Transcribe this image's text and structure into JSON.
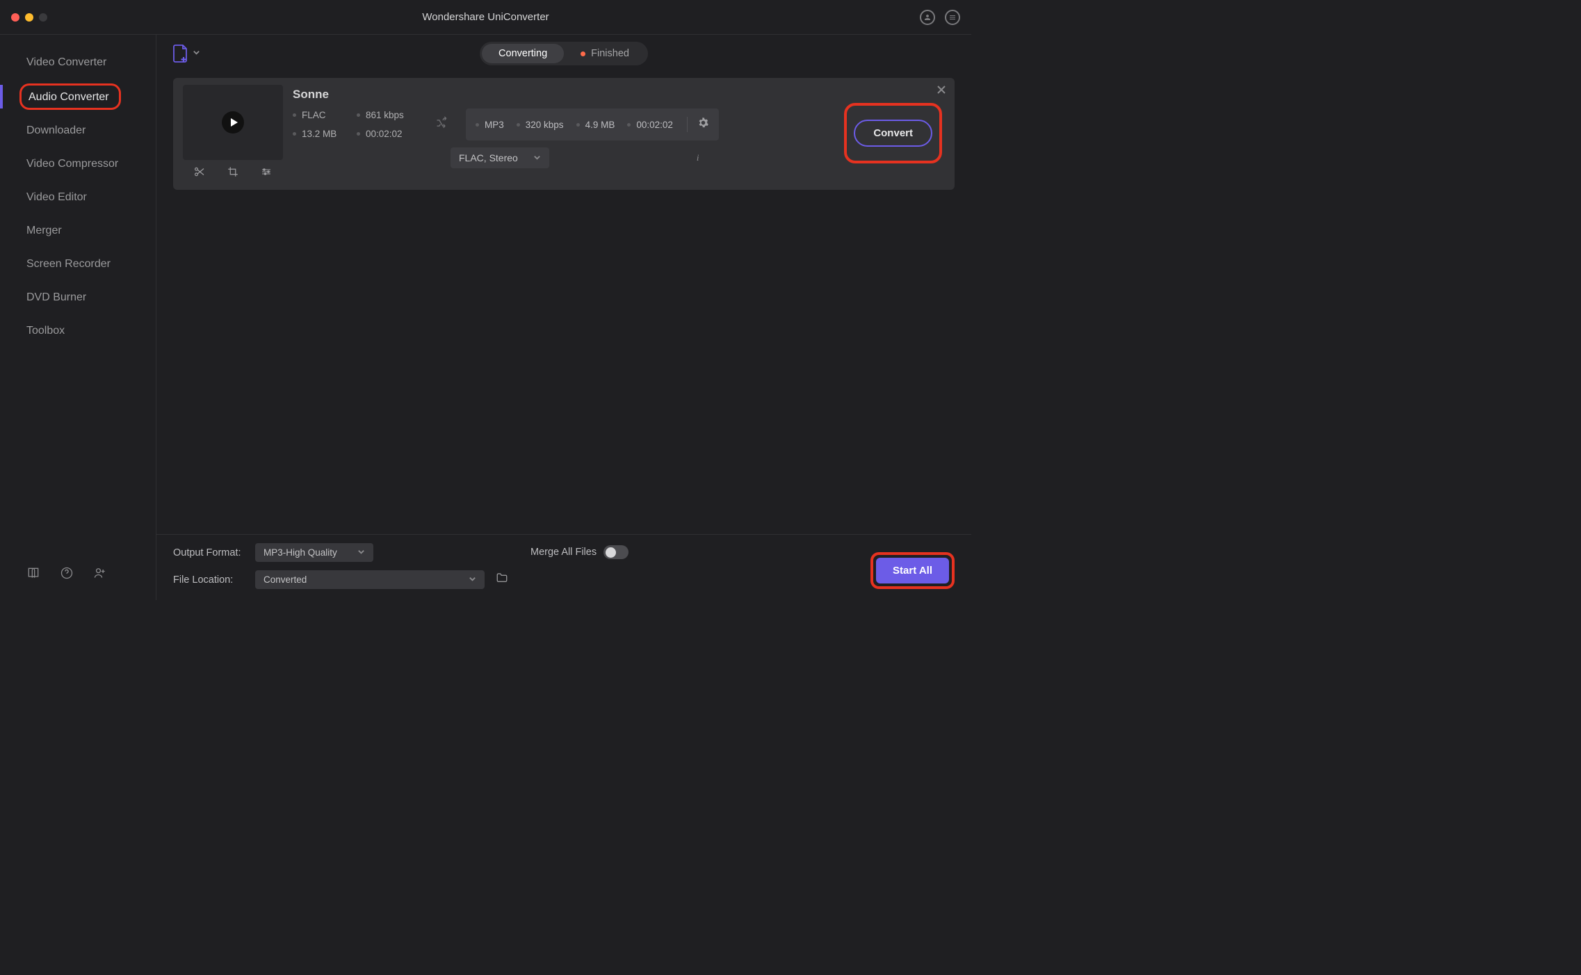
{
  "app": {
    "title": "Wondershare UniConverter"
  },
  "sidebar": {
    "items": [
      {
        "label": "Video Converter"
      },
      {
        "label": "Audio Converter"
      },
      {
        "label": "Downloader"
      },
      {
        "label": "Video Compressor"
      },
      {
        "label": "Video Editor"
      },
      {
        "label": "Merger"
      },
      {
        "label": "Screen Recorder"
      },
      {
        "label": "DVD Burner"
      },
      {
        "label": "Toolbox"
      }
    ]
  },
  "segment": {
    "converting": "Converting",
    "finished": "Finished"
  },
  "file": {
    "title": "Sonne",
    "src": {
      "format": "FLAC",
      "bitrate": "861 kbps",
      "size": "13.2 MB",
      "duration": "00:02:02"
    },
    "dst": {
      "format": "MP3",
      "bitrate": "320 kbps",
      "size": "4.9 MB",
      "duration": "00:02:02"
    },
    "format_select": "FLAC, Stereo",
    "convert_label": "Convert"
  },
  "bottom": {
    "output_format_label": "Output Format:",
    "output_format_value": "MP3-High Quality",
    "merge_label": "Merge All Files",
    "file_location_label": "File Location:",
    "file_location_value": "Converted",
    "start_all": "Start All"
  }
}
